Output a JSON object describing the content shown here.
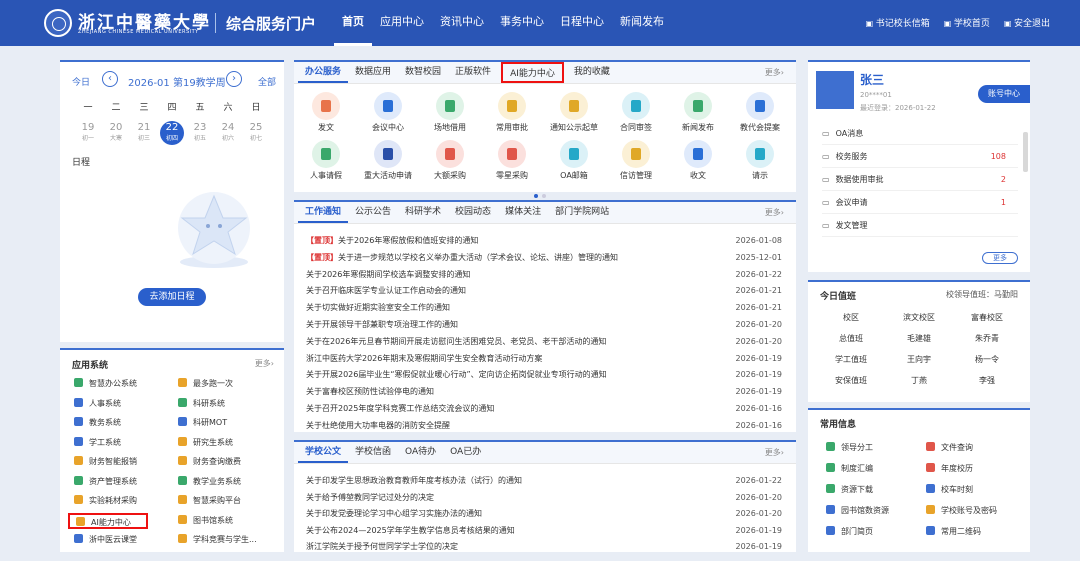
{
  "header": {
    "univ_name": "浙江中醫藥大學",
    "univ_name_en": "ZHEJIANG CHINESE MEDICAL UNIVERSITY",
    "portal_title": "综合服务门户",
    "nav": [
      "首页",
      "应用中心",
      "资讯中心",
      "事务中心",
      "日程中心",
      "新闻发布"
    ],
    "links": [
      "书记校长信箱",
      "学校首页",
      "安全退出"
    ]
  },
  "calendar": {
    "today_label": "今日",
    "prev": "‹",
    "next": "›",
    "title": "2026-01 第19教学周",
    "all_label": "全部",
    "weekdays": [
      "一",
      "二",
      "三",
      "四",
      "五",
      "六",
      "日"
    ],
    "days": [
      {
        "num": "19",
        "sub": "初一"
      },
      {
        "num": "20",
        "sub": "大寒"
      },
      {
        "num": "21",
        "sub": "初三"
      },
      {
        "num": "22",
        "sub": "初四"
      },
      {
        "num": "23",
        "sub": "初五"
      },
      {
        "num": "24",
        "sub": "初六"
      },
      {
        "num": "25",
        "sub": "初七"
      }
    ],
    "schedule_label": "日程",
    "add_schedule": "去添加日程"
  },
  "apps": {
    "title": "应用系统",
    "more": "更多›",
    "items": [
      {
        "label": "智慧办公系统",
        "color": "#3aa86b"
      },
      {
        "label": "最多跑一次",
        "color": "#e8a32a"
      },
      {
        "label": "人事系统",
        "color": "#3e6fd0"
      },
      {
        "label": "科研系统",
        "color": "#3aa86b"
      },
      {
        "label": "教务系统",
        "color": "#3e6fd0"
      },
      {
        "label": "科研MOT",
        "color": "#3e6fd0"
      },
      {
        "label": "学工系统",
        "color": "#3e6fd0"
      },
      {
        "label": "研究生系统",
        "color": "#e8a32a"
      },
      {
        "label": "财务智能报销",
        "color": "#e8a32a"
      },
      {
        "label": "财务查询缴费",
        "color": "#e8a32a"
      },
      {
        "label": "资产管理系统",
        "color": "#3aa86b"
      },
      {
        "label": "教学业务系统",
        "color": "#3aa86b"
      },
      {
        "label": "实验耗材采购",
        "color": "#e8a32a"
      },
      {
        "label": "智慧采购平台",
        "color": "#e8a32a"
      },
      {
        "label": "AI能力中心",
        "color": "#e8a32a"
      },
      {
        "label": "图书馆系统",
        "color": "#e8a32a"
      },
      {
        "label": "浙中医云课堂",
        "color": "#3e6fd0"
      },
      {
        "label": "学科竞赛与学生...",
        "color": "#e8a32a"
      }
    ]
  },
  "office": {
    "tabs": [
      "办公服务",
      "数据应用",
      "数智校园",
      "正版软件",
      "AI能力中心",
      "我的收藏"
    ],
    "more": "更多›",
    "icons": [
      {
        "label": "发文",
        "color": "#e8734a",
        "bg": "#fde8df"
      },
      {
        "label": "会议中心",
        "color": "#2a6fd6",
        "bg": "#dfeafb"
      },
      {
        "label": "场地借用",
        "color": "#3aa86b",
        "bg": "#dff3e7"
      },
      {
        "label": "常用审批",
        "color": "#e0a826",
        "bg": "#fbf0d5"
      },
      {
        "label": "通知公示起草",
        "color": "#e0a826",
        "bg": "#fbf0d5"
      },
      {
        "label": "合同审签",
        "color": "#25a8c8",
        "bg": "#dbf1f7"
      },
      {
        "label": "新闻发布",
        "color": "#3aa86b",
        "bg": "#dff3e7"
      },
      {
        "label": "教代会提案",
        "color": "#2a6fd6",
        "bg": "#dfeafb"
      },
      {
        "label": "人事请假",
        "color": "#3aa86b",
        "bg": "#dff3e7"
      },
      {
        "label": "重大活动申请",
        "color": "#2a4fa8",
        "bg": "#dfe6f7"
      },
      {
        "label": "大额采购",
        "color": "#e0564a",
        "bg": "#fbe0dd"
      },
      {
        "label": "零星采购",
        "color": "#e0564a",
        "bg": "#fbe0dd"
      },
      {
        "label": "OA邮箱",
        "color": "#25a8c8",
        "bg": "#dbf1f7"
      },
      {
        "label": "信访管理",
        "color": "#e0a826",
        "bg": "#fbf0d5"
      },
      {
        "label": "收文",
        "color": "#2a6fd6",
        "bg": "#dfeafb"
      },
      {
        "label": "请示",
        "color": "#25a8c8",
        "bg": "#dbf1f7"
      }
    ]
  },
  "notices": {
    "tabs": [
      "工作通知",
      "公示公告",
      "科研学术",
      "校园动态",
      "媒体关注",
      "部门学院网站"
    ],
    "more": "更多›",
    "rows": [
      {
        "tag": "【置顶】",
        "title": "关于2026年寒假放假和值班安排的通知",
        "date": "2026-01-08"
      },
      {
        "tag": "【置顶】",
        "title": "关于进一步规范以学校名义举办重大活动（学术会议、论坛、讲座）管理的通知",
        "date": "2025-12-01"
      },
      {
        "tag": "",
        "title": "关于2026年寒假期间学校选车调整安排的通知",
        "date": "2026-01-22"
      },
      {
        "tag": "",
        "title": "关于召开临床医学专业认证工作启动会的通知",
        "date": "2026-01-21"
      },
      {
        "tag": "",
        "title": "关于切实做好近期实验室安全工作的通知",
        "date": "2026-01-21"
      },
      {
        "tag": "",
        "title": "关于开展领导干部兼职专项治理工作的通知",
        "date": "2026-01-20"
      },
      {
        "tag": "",
        "title": "关于在2026年元旦春节期间开展走访慰问生活困难党员、老党员、老干部活动的通知",
        "date": "2026-01-20"
      },
      {
        "tag": "",
        "title": "浙江中医药大学2026年期末及寒假期间学生安全教育活动行动方案",
        "date": "2026-01-19"
      },
      {
        "tag": "",
        "title": "关于开展2026届毕业生“寒假促就业暖心行动”、定向访企拓岗促就业专项行动的通知",
        "date": "2026-01-19"
      },
      {
        "tag": "",
        "title": "关于富春校区预防性试验停电的通知",
        "date": "2026-01-19"
      },
      {
        "tag": "",
        "title": "关于召开2025年度学科竞赛工作总结交流会议的通知",
        "date": "2026-01-16"
      },
      {
        "tag": "",
        "title": "关于杜绝使用大功率电器的消防安全提醒",
        "date": "2026-01-16"
      }
    ]
  },
  "documents": {
    "tabs": [
      "学校公文",
      "学校信函",
      "OA待办",
      "OA已办"
    ],
    "more": "更多›",
    "rows": [
      {
        "title": "关于印发学生思想政治教育教师年度考核办法（试行）的通知",
        "date": "2026-01-22"
      },
      {
        "title": "关于给予傅堃教同学记过处分的决定",
        "date": "2026-01-20"
      },
      {
        "title": "关于印发党委理论学习中心组学习实施办法的通知",
        "date": "2026-01-20"
      },
      {
        "title": "关于公布2024—2025学年学生教学信息员考核结果的通知",
        "date": "2026-01-19"
      },
      {
        "title": "浙江学院关于授予何世同学学士学位的决定",
        "date": "2026-01-19"
      }
    ]
  },
  "profile": {
    "name": "张三",
    "id": "20****01",
    "last_login": "最近登录：2026-01-22",
    "account_button": "账号中心",
    "items": [
      {
        "label": "OA消息",
        "count": ""
      },
      {
        "label": "校务服务",
        "count": "108"
      },
      {
        "label": "数据使用审批",
        "count": "2"
      },
      {
        "label": "会议申请",
        "count": "1"
      },
      {
        "label": "发文管理",
        "count": ""
      }
    ],
    "more": "更多"
  },
  "duty": {
    "title": "今日值班",
    "leader": "校领导值班：马勤阳",
    "rows": [
      [
        "校区",
        "滨文校区",
        "富春校区"
      ],
      [
        "总值班",
        "毛建雄",
        "朱乔青"
      ],
      [
        "学工值班",
        "王向宇",
        "杨一令"
      ],
      [
        "安保值班",
        "丁燕",
        "李强"
      ]
    ]
  },
  "common_info": {
    "title": "常用信息",
    "items": [
      {
        "label": "领导分工",
        "color": "#3aa86b"
      },
      {
        "label": "文件查询",
        "color": "#e0564a"
      },
      {
        "label": "制度汇编",
        "color": "#3aa86b"
      },
      {
        "label": "年度校历",
        "color": "#e0564a"
      },
      {
        "label": "资源下载",
        "color": "#3aa86b"
      },
      {
        "label": "校车时刻",
        "color": "#3e6fd0"
      },
      {
        "label": "园书馆数资源",
        "color": "#3e6fd0"
      },
      {
        "label": "学校账号及密码",
        "color": "#e8a32a"
      },
      {
        "label": "部门简页",
        "color": "#3e6fd0"
      },
      {
        "label": "常用二维码",
        "color": "#3e6fd0"
      }
    ]
  }
}
